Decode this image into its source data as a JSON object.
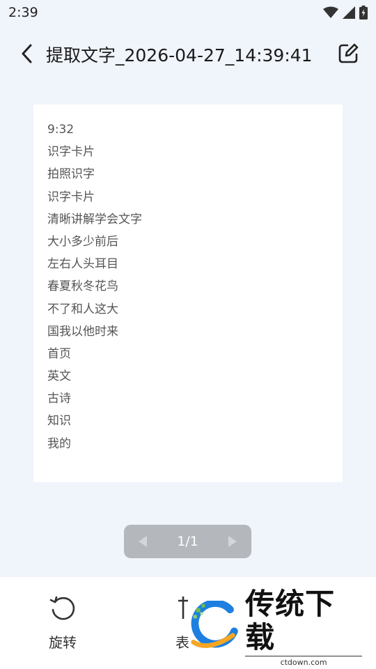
{
  "status_bar": {
    "time": "2:39"
  },
  "header": {
    "title": "提取文字_2026-04-27_14:39:41"
  },
  "document": {
    "lines": [
      "9:32",
      "识字卡片",
      "拍照识字",
      "识字卡片",
      "清晰讲解学会文字",
      "大小多少前后",
      "左右人头耳目",
      "春夏秋冬花鸟",
      "不了和人这大",
      "国我以他时来",
      "首页",
      "英文",
      "古诗",
      "知识",
      "我的"
    ]
  },
  "pager": {
    "label": "1/1"
  },
  "toolbar": {
    "rotate_label": "旋转",
    "table_label": "表"
  },
  "watermark": {
    "title": "传统下载",
    "url": "ctdown.com"
  },
  "colors": {
    "background": "#f0f4fb",
    "pager_bg": "#b4b7bc",
    "logo_blue": "#1e7fe0",
    "logo_orange": "#f5a623",
    "logo_green": "#6cc04a"
  }
}
